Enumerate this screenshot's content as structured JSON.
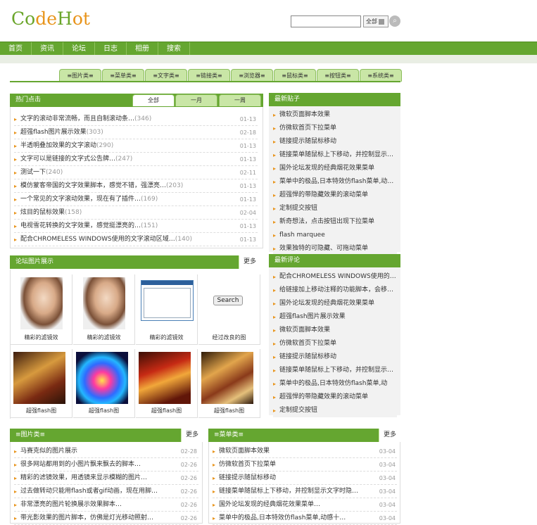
{
  "logo": {
    "part1": "Co",
    "part2": "de",
    "part3": "H",
    "part4": "ot"
  },
  "search": {
    "scope": "全部",
    "go_icon": "magnifier-icon"
  },
  "nav": [
    "首页",
    "资讯",
    "论坛",
    "日志",
    "相册",
    "搜索"
  ],
  "categories": [
    "≡图片类≡",
    "≡菜单类≡",
    "≡文字类≡",
    "≡链接类≡",
    "≡浏览器≡",
    "≡鼠标类≡",
    "≡按钮类≡",
    "≡系统类≡"
  ],
  "hot": {
    "title": "热门点击",
    "tabs": [
      "全部",
      "一月",
      "一周"
    ],
    "items": [
      {
        "text": "文字的滚动非常流畅，而且自制滚动条…",
        "count": "(346)",
        "date": "01-13"
      },
      {
        "text": "超强flash图片展示效果",
        "count": "(303)",
        "date": "02-18"
      },
      {
        "text": "半透明叠加效果的文字滚动",
        "count": "(290)",
        "date": "01-13"
      },
      {
        "text": "文字可以是链接的文字式公告牌…",
        "count": "(247)",
        "date": "01-13"
      },
      {
        "text": "测试一下",
        "count": "(240)",
        "date": "02-11"
      },
      {
        "text": "模仿蒙客帝国的文字效果脚本，感觉不错，强漂亮…",
        "count": "(203)",
        "date": "01-13"
      },
      {
        "text": "一个常见的文字滚动效果，现在有了插件…",
        "count": "(169)",
        "date": "01-13"
      },
      {
        "text": "炫目的鼠标效果",
        "count": "(158)",
        "date": "02-04"
      },
      {
        "text": "电视雪花转换的文字效果，感觉挺漂亮的…",
        "count": "(151)",
        "date": "01-13"
      },
      {
        "text": "配合CHROMELESS WINDOWS使用的文字滚动区域…",
        "count": "(140)",
        "date": "01-13"
      }
    ]
  },
  "latest_posts": {
    "title": "最新贴子",
    "items": [
      "微软页面脚本效果",
      "仿微软首页下拉菜单",
      "链接提示随鼠标移动",
      "链接菜单随鼠标上下移动，并控制显示…",
      "国外论坛发现的经典烟花效果菜单",
      "菜单中的极品,日本特效仿flash菜单,动…",
      "超强悍的带隐藏效果的滚动菜单",
      "定制提交按钮",
      "新奇想法，点击按钮出现下拉菜单",
      "flash marquee",
      "效果独特的可隐藏、可拖动菜单"
    ]
  },
  "gallery": {
    "title": "论坛图片展示",
    "more": "更多",
    "row1": [
      "精彩的滤镜效",
      "精彩的滤镜效",
      "精彩的滤镜效",
      "经过改良的图"
    ],
    "row2": [
      "超强flash图",
      "超强flash图",
      "超强flash图",
      "超强flash图"
    ],
    "search_button": "Search"
  },
  "latest_comments": {
    "title": "最新评论",
    "items": [
      "配合CHROMELESS WINDOWS使用的…",
      "给链接加上移动注释的功能脚本，会移…",
      "国外论坛发现的经典烟花效果菜单",
      "超强flash图片展示效果",
      "微软页面脚本效果",
      "仿微软首页下拉菜单",
      "链接提示随鼠标移动",
      "链接菜单随鼠标上下移动，并控制显示…",
      "菜单中的极品,日本特效仿flash菜单,动",
      "超强悍的带隐藏效果的滚动菜单",
      "定制提交按钮"
    ]
  },
  "picture_cat": {
    "title": "≡图片类≡",
    "more": "更多",
    "items": [
      {
        "text": "马赛克似的图片展示",
        "date": "02-28"
      },
      {
        "text": "很多网站都用到的小图片飘来飘去的脚本…",
        "date": "02-26"
      },
      {
        "text": "精彩的滤镜效果，用透镜来显示模糊的图片…",
        "date": "02-26"
      },
      {
        "text": "过去做转动只能用flash或者gif动画，现在用脚…",
        "date": "02-26"
      },
      {
        "text": "非常漂亮的图片轮换展示效果脚本…",
        "date": "02-26"
      },
      {
        "text": "带光影效果的图片脚本，仿佛是灯光移动照射…",
        "date": "02-26"
      }
    ]
  },
  "menu_cat": {
    "title": "≡菜单类≡",
    "more": "更多",
    "items": [
      {
        "text": "微软页面脚本效果",
        "date": "03-04"
      },
      {
        "text": "仿微软首页下拉菜单",
        "date": "03-04"
      },
      {
        "text": "链接提示随鼠标移动",
        "date": "03-04"
      },
      {
        "text": "链接菜单随鼠标上下移动，并控制显示文字时隐…",
        "date": "03-04"
      },
      {
        "text": "国外论坛发现的经典烟花效果菜单…",
        "date": "03-04"
      },
      {
        "text": "菜单中的极品,日本特效仿flash菜单,动感十…",
        "date": "03-04"
      }
    ]
  }
}
